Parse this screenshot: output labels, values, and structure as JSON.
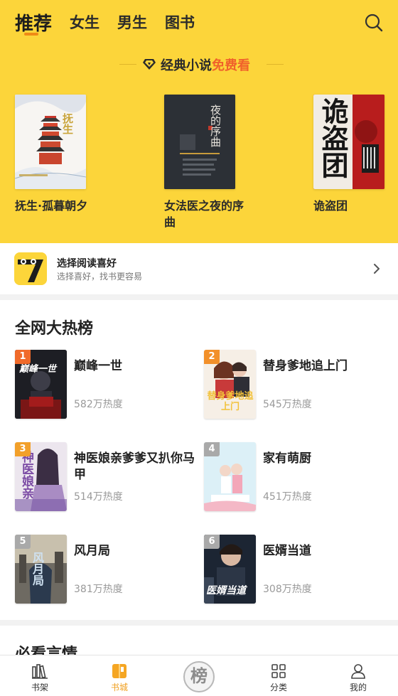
{
  "tabs": [
    {
      "label": "推荐",
      "active": true
    },
    {
      "label": "女生"
    },
    {
      "label": "男生"
    },
    {
      "label": "图书"
    }
  ],
  "promo": {
    "text": "经典小说",
    "highlight": "免费看"
  },
  "featured": [
    {
      "title": "抚生·孤暮朝夕",
      "cover_text": "抚生"
    },
    {
      "title": "女法医之夜的序曲",
      "cover_text": "夜的序曲"
    },
    {
      "title": "诡盗团",
      "cover_text": "诡盗团"
    }
  ],
  "preference": {
    "title": "选择阅读喜好",
    "subtitle": "选择喜好，找书更容易"
  },
  "ranking": {
    "title": "全网大热榜",
    "items": [
      {
        "rank": "1",
        "title": "巅峰一世",
        "heat": "582万热度",
        "cover_text": "巅峰一世",
        "badge_color": "#f06a2a"
      },
      {
        "rank": "2",
        "title": "替身爹地追上门",
        "heat": "545万热度",
        "cover_text": "替身爹地追上门",
        "badge_color": "#f2902a"
      },
      {
        "rank": "3",
        "title": "神医娘亲爹爹又扒你马甲",
        "heat": "514万热度",
        "cover_text": "神医娘亲",
        "badge_color": "#f2a02a"
      },
      {
        "rank": "4",
        "title": "家有萌厨",
        "heat": "451万热度",
        "cover_text": "",
        "badge_color": "#a9a9a9"
      },
      {
        "rank": "5",
        "title": "风月局",
        "heat": "381万热度",
        "cover_text": "风月局",
        "badge_color": "#a9a9a9"
      },
      {
        "rank": "6",
        "title": "医婿当道",
        "heat": "308万热度",
        "cover_text": "医婿当道",
        "badge_color": "#a9a9a9"
      }
    ]
  },
  "next_section": {
    "title": "必看言情"
  },
  "nav": [
    {
      "label": "书架",
      "icon": "bookshelf-icon"
    },
    {
      "label": "书城",
      "icon": "bookstore-icon",
      "active": true
    },
    {
      "label": "榜",
      "icon": "ranking-badge-icon"
    },
    {
      "label": "分类",
      "icon": "category-grid-icon"
    },
    {
      "label": "我的",
      "icon": "profile-icon"
    }
  ]
}
